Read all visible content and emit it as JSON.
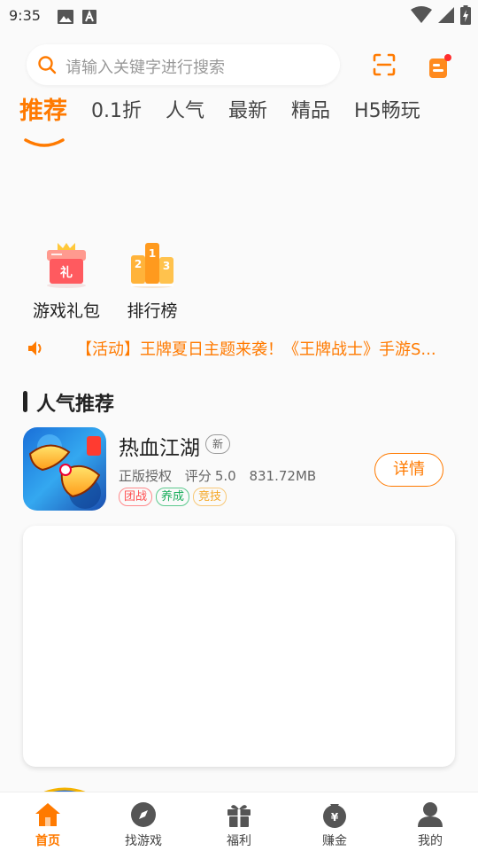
{
  "status_bar": {
    "time": "9:35",
    "left_icons": [
      "image-icon",
      "font-icon"
    ],
    "right_icons": [
      "wifi-icon",
      "signal-icon",
      "battery-icon"
    ]
  },
  "search": {
    "placeholder": "请输入关键字进行搜索",
    "scan_icon": "scan-icon",
    "message_icon": "message-icon",
    "message_badge_color": "#ff2d2d"
  },
  "tabs": [
    {
      "label": "推荐",
      "active": true
    },
    {
      "label": "0.1折"
    },
    {
      "label": "人气"
    },
    {
      "label": "最新"
    },
    {
      "label": "精品"
    },
    {
      "label": "H5畅玩"
    }
  ],
  "shortcuts": [
    {
      "label": "游戏礼包",
      "icon": "gift-box-icon",
      "icon_text": "礼"
    },
    {
      "label": "排行榜",
      "icon": "podium-icon",
      "ranks": [
        "2",
        "1",
        "3"
      ]
    }
  ],
  "notice": {
    "icon": "speaker-icon",
    "text": "【活动】王牌夏日主题来袭！《王牌战士》手游S..."
  },
  "section": {
    "title": "人气推荐"
  },
  "games": [
    {
      "name": "热血江湖",
      "badge": "新",
      "license": "正版授权",
      "rating_label": "评分",
      "rating": "5.0",
      "size": "831.72MB",
      "tags": [
        {
          "label": "团战",
          "color": "#ff4d4f"
        },
        {
          "label": "养成",
          "color": "#1aad5c"
        },
        {
          "label": "竞技",
          "color": "#f5a623"
        }
      ],
      "action_label": "详情"
    }
  ],
  "bottom_nav": [
    {
      "label": "首页",
      "icon": "home-icon",
      "active": true
    },
    {
      "label": "找游戏",
      "icon": "compass-icon"
    },
    {
      "label": "福利",
      "icon": "gift-icon"
    },
    {
      "label": "赚金",
      "icon": "money-bag-icon",
      "icon_text": "¥"
    },
    {
      "label": "我的",
      "icon": "user-icon"
    }
  ],
  "colors": {
    "accent": "#ff7a00",
    "nav_inactive": "#444444",
    "text": "#222222"
  }
}
